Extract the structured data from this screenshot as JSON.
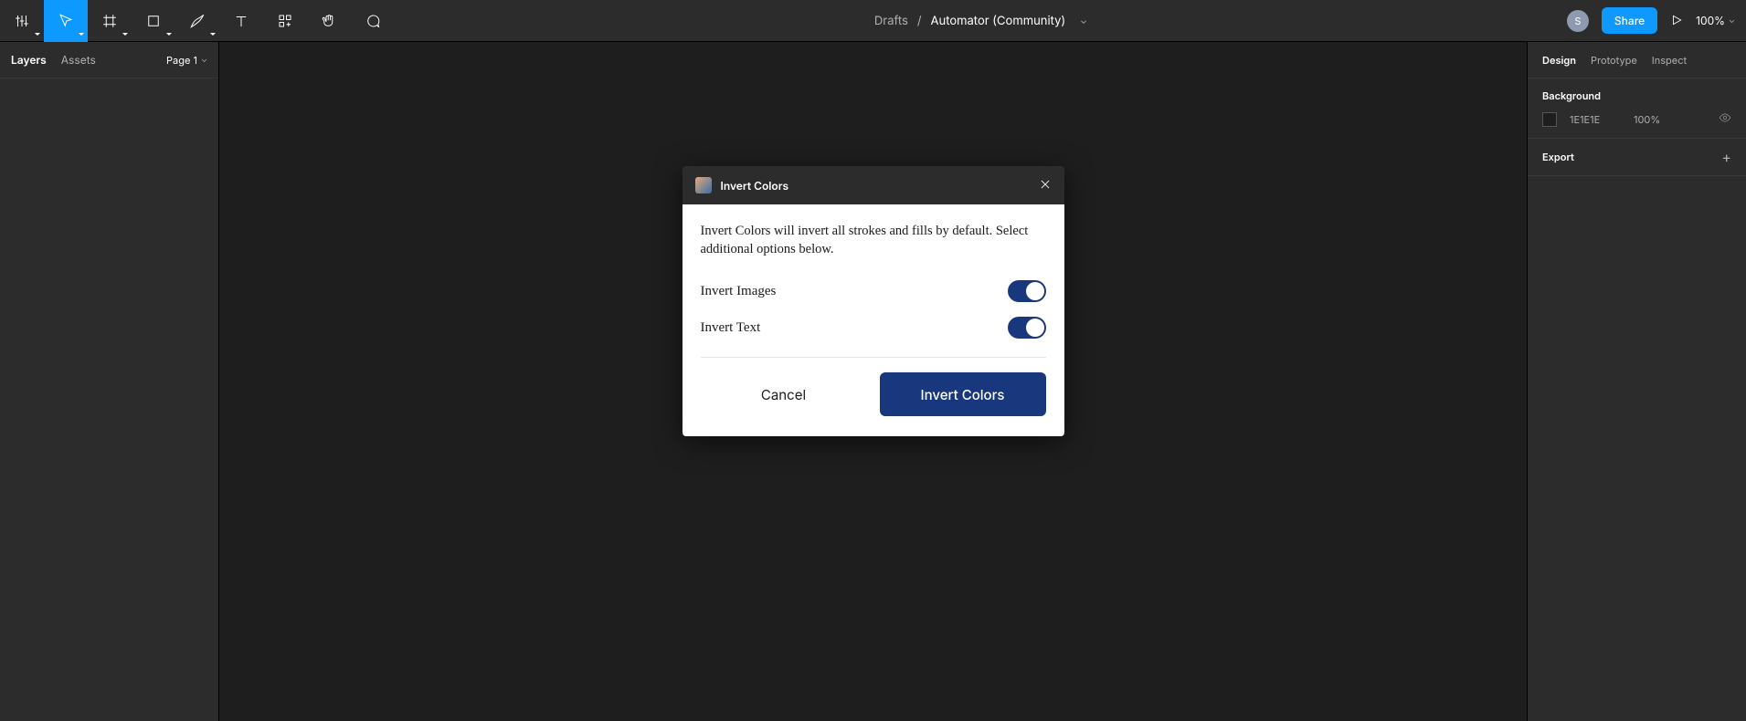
{
  "breadcrumb": {
    "drafts": "Drafts",
    "separator": "/",
    "file": "Automator (Community)"
  },
  "toolbar": {
    "share": "Share",
    "zoom": "100%",
    "avatar_initial": "S"
  },
  "left_panel": {
    "tabs": {
      "layers": "Layers",
      "assets": "Assets"
    },
    "page": "Page 1"
  },
  "right_panel": {
    "tabs": {
      "design": "Design",
      "prototype": "Prototype",
      "inspect": "Inspect"
    },
    "background": {
      "label": "Background",
      "hex": "1E1E1E",
      "opacity": "100%"
    },
    "export": {
      "label": "Export"
    }
  },
  "dialog": {
    "title": "Invert Colors",
    "description": "Invert Colors will invert all strokes and fills by default. Select additional options below.",
    "options": {
      "images": {
        "label": "Invert Images",
        "on": true
      },
      "text": {
        "label": "Invert Text",
        "on": true
      }
    },
    "cancel": "Cancel",
    "confirm": "Invert Colors"
  }
}
